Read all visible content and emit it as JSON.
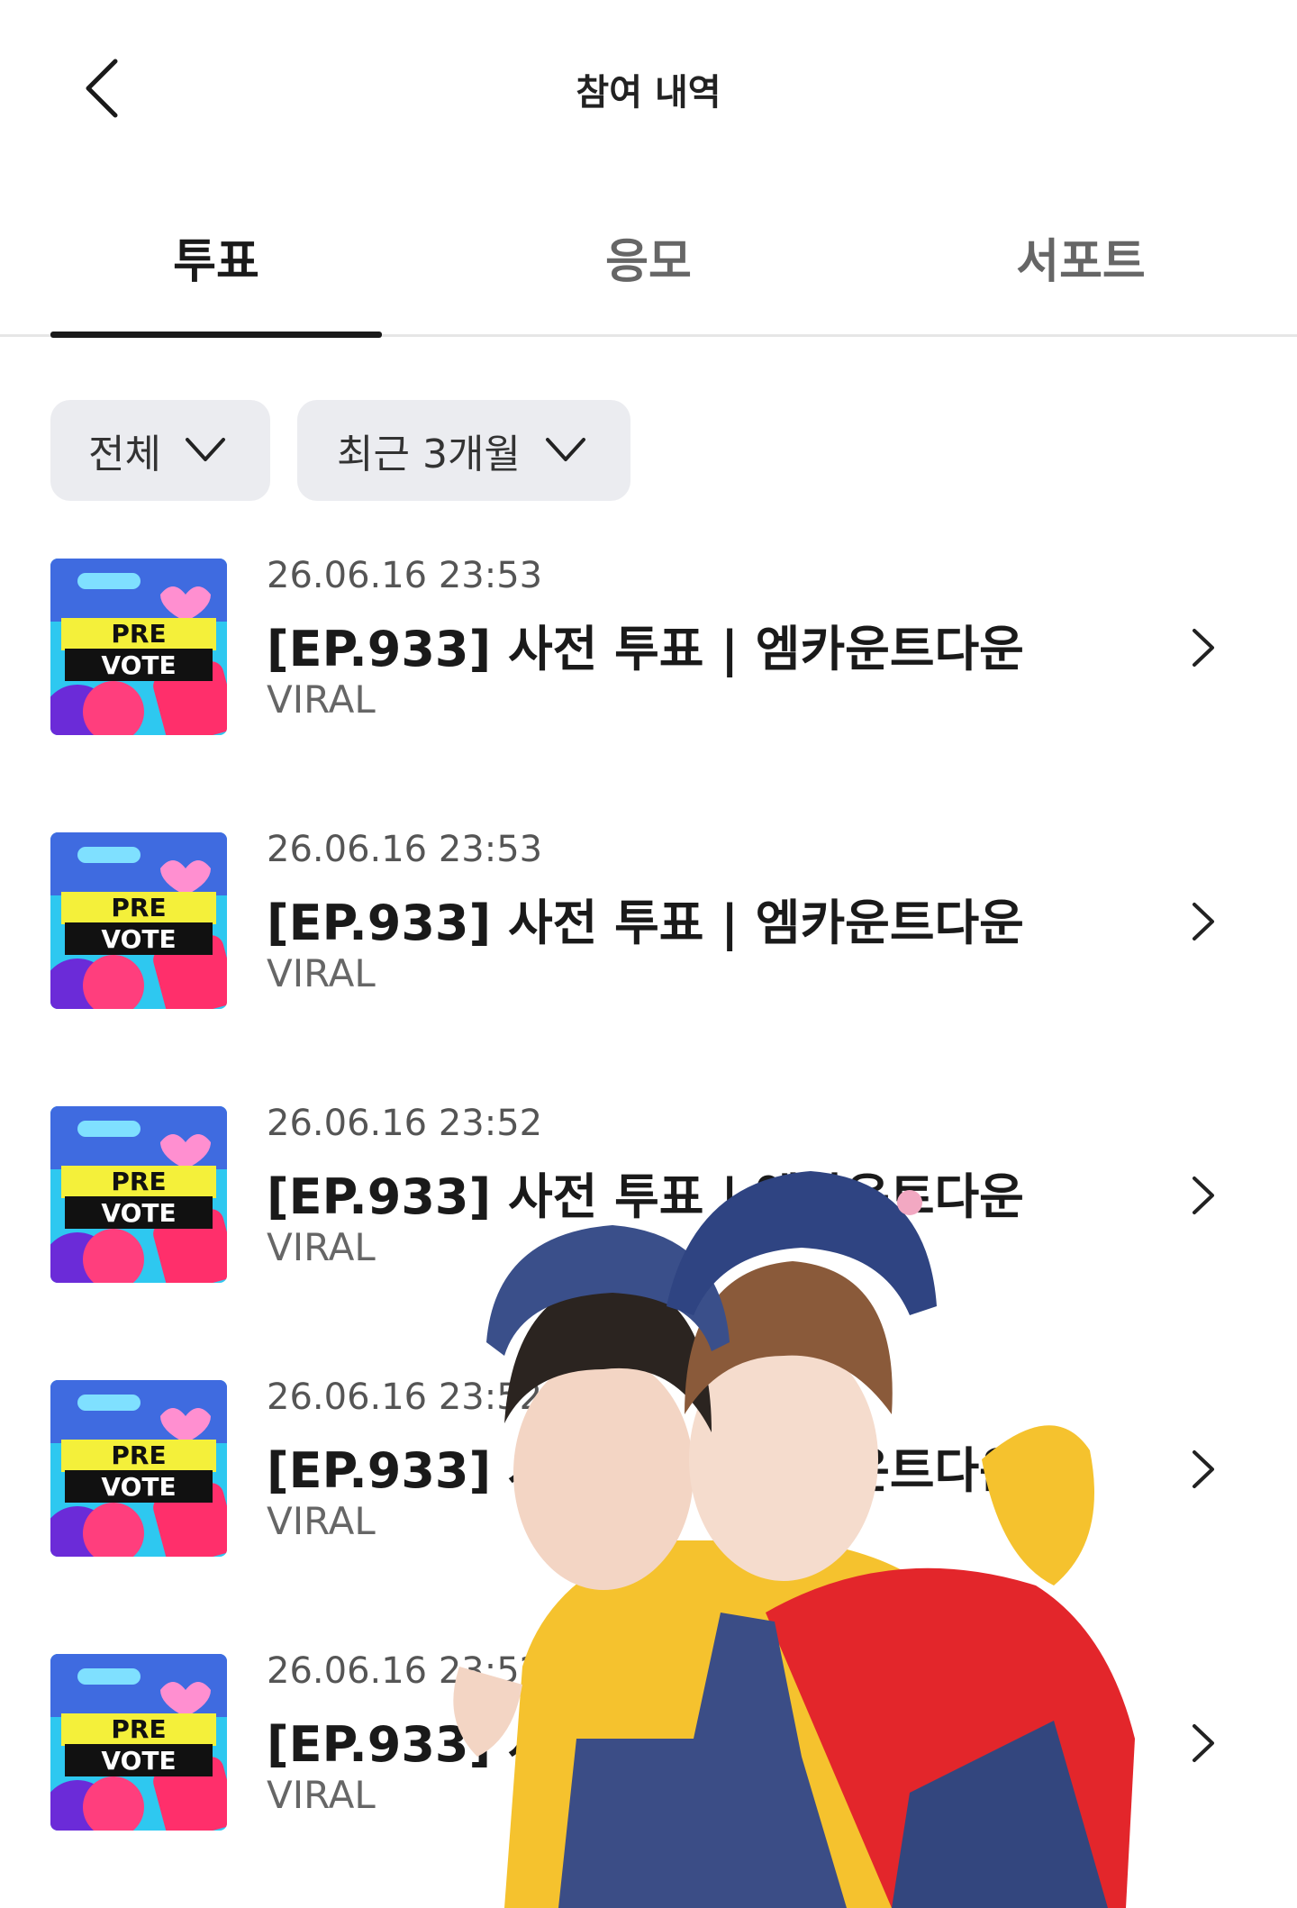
{
  "header": {
    "title": "참여 내역",
    "back_icon": "back-arrow-icon"
  },
  "tabs": [
    {
      "label": "투표",
      "active": true
    },
    {
      "label": "응모",
      "active": false
    },
    {
      "label": "서포트",
      "active": false
    }
  ],
  "filters": [
    {
      "label": "전체",
      "icon": "chevron-down-icon"
    },
    {
      "label": "최근 3개월",
      "icon": "chevron-down-icon"
    }
  ],
  "thumbnail": {
    "line1": "PRE",
    "line2": "VOTE"
  },
  "items": [
    {
      "date": "26.06.16 23:53",
      "title": "[EP.933] 사전 투표 | 엠카운트다운",
      "sub": "VIRAL"
    },
    {
      "date": "26.06.16 23:53",
      "title": "[EP.933] 사전 투표 | 엠카운트다운",
      "sub": "VIRAL"
    },
    {
      "date": "26.06.16 23:52",
      "title": "[EP.933] 사전 투표 | 엠카운트다운",
      "sub": "VIRAL"
    },
    {
      "date": "26.06.16 23:52",
      "title": "[EP.933] 사전 투표 | 엠카운트다운",
      "sub": "VIRAL"
    },
    {
      "date": "26.06.16 23:52",
      "title": "[EP.933] 사전 투표 | 엠카운트다운",
      "sub": "VIRAL"
    }
  ],
  "colors": {
    "active_tab": "#1a1a1a",
    "inactive_tab": "#666666",
    "filter_bg": "#ebecf0"
  }
}
